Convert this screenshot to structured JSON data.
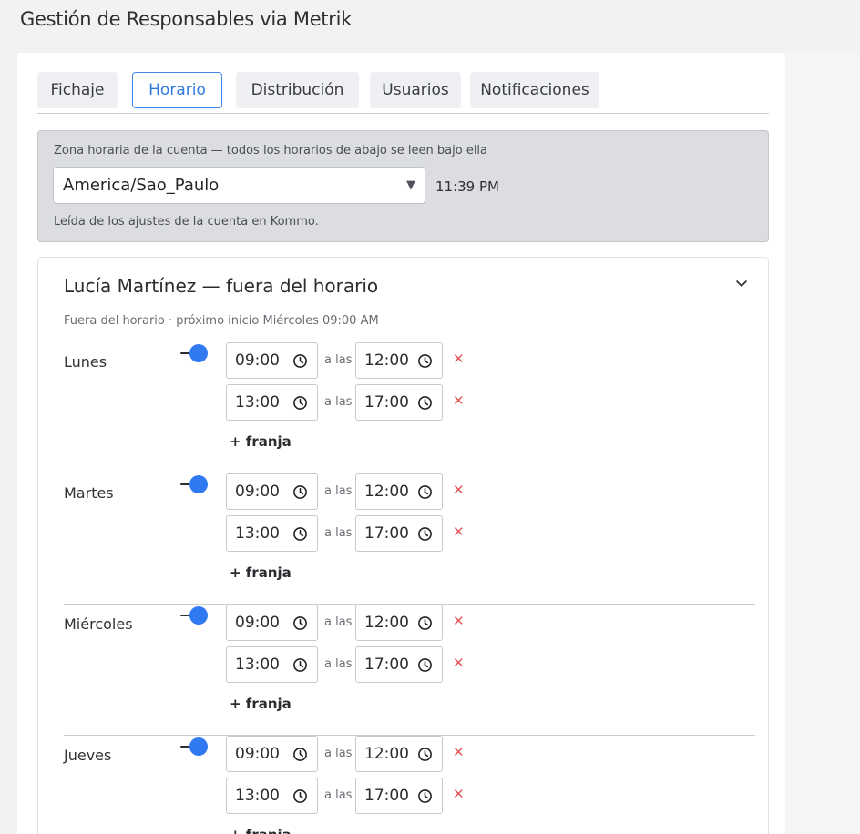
{
  "page": {
    "title": "Gestión de Responsables via Metrik"
  },
  "tabs": [
    "Fichaje",
    "Horario",
    "Distribución",
    "Usuarios",
    "Notificaciones"
  ],
  "active_tab": "Horario",
  "timezone": {
    "label": "Zona horaria de la cuenta — todos los horarios de abajo se leen bajo ella",
    "value": "America/Sao_Paulo",
    "current_time": "11:39 PM",
    "note": "Leída de los ajustes de la cuenta en Kommo."
  },
  "responsable": {
    "title": "Lucía Martínez — fuera del horario",
    "status": "Fuera del horario · próximo inicio Miércoles 09:00 AM",
    "separator_label": "a las",
    "add_slot_label": "+ franja",
    "days": [
      {
        "name": "Lunes",
        "enabled": true,
        "slots": [
          {
            "from": "09:00",
            "to": "12:00"
          },
          {
            "from": "13:00",
            "to": "17:00"
          }
        ]
      },
      {
        "name": "Martes",
        "enabled": true,
        "slots": [
          {
            "from": "09:00",
            "to": "12:00"
          },
          {
            "from": "13:00",
            "to": "17:00"
          }
        ]
      },
      {
        "name": "Miércoles",
        "enabled": true,
        "slots": [
          {
            "from": "09:00",
            "to": "12:00"
          },
          {
            "from": "13:00",
            "to": "17:00"
          }
        ]
      },
      {
        "name": "Jueves",
        "enabled": true,
        "slots": [
          {
            "from": "09:00",
            "to": "12:00"
          },
          {
            "from": "13:00",
            "to": "17:00"
          }
        ]
      }
    ]
  },
  "icons": {
    "clock": "clock-icon",
    "remove": "remove-slot-icon",
    "expand": "chevron-down-icon",
    "dropdown": "caret-down-icon"
  },
  "colors": {
    "accent": "#3079f0",
    "remove": "#e0565a",
    "tz_bg": "#dcdde0"
  }
}
